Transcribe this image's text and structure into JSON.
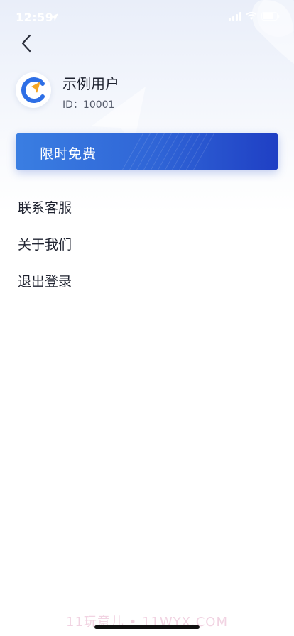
{
  "status_bar": {
    "time": "12:59"
  },
  "header": {
    "back_icon": "chevron-left-icon"
  },
  "profile": {
    "name": "示例用户",
    "id_text": "ID：10001",
    "avatar_icon": "navigation-logo-icon"
  },
  "promo": {
    "label": "限时免费"
  },
  "menu": {
    "items": [
      {
        "label": "联系客服"
      },
      {
        "label": "关于我们"
      },
      {
        "label": "退出登录"
      }
    ]
  },
  "footer": {
    "watermark": "11玩意儿 • 11WYX.COM"
  },
  "colors": {
    "accent": "#2f64d6",
    "banner_start": "#3a7ee2",
    "banner_end": "#1f3fc4",
    "logo_blue": "#2e6fe6",
    "logo_orange": "#f5a623"
  }
}
